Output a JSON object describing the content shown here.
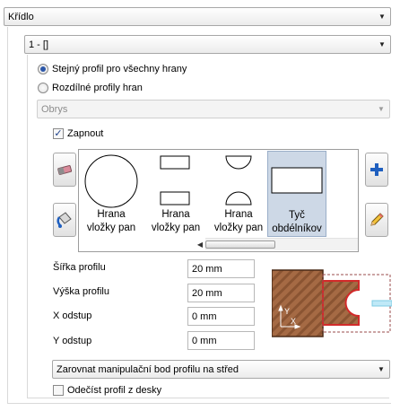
{
  "main_combo": {
    "value": "Křídlo"
  },
  "sub_combo": {
    "value": "1 - []"
  },
  "profile_mode": {
    "option_same": "Stejný profil pro všechny hrany",
    "option_different": "Rozdílné profily hran",
    "selected": "same"
  },
  "edge_combo": {
    "value": "Obrys",
    "disabled": true
  },
  "enable_checkbox": {
    "label": "Zapnout",
    "checked": true
  },
  "gallery": {
    "items": [
      {
        "line1": "Hrana",
        "line2": "vložky pan",
        "shape": "circle"
      },
      {
        "line1": "Hrana",
        "line2": "vložky pan",
        "shape": "two-rects"
      },
      {
        "line1": "Hrana",
        "line2": "vložky pan",
        "shape": "half-circles"
      },
      {
        "line1": "Tyč",
        "line2": "obdélníkov",
        "shape": "rect",
        "selected": true
      }
    ]
  },
  "fields": {
    "width": {
      "label": "Šířka profilu",
      "value": "20 mm"
    },
    "height": {
      "label": "Výška profilu",
      "value": "20 mm"
    },
    "x_offset": {
      "label": "X odstup",
      "value": "0 mm"
    },
    "y_offset": {
      "label": "Y odstup",
      "value": "0 mm"
    }
  },
  "preview": {
    "axis_x": "X",
    "axis_y": "Y"
  },
  "align_combo": {
    "value": "Zarovnat manipulační bod profilu na střed"
  },
  "subtract_checkbox": {
    "label": "Odečíst profil z desky",
    "checked": false
  },
  "icons": {
    "left_top": "eraser-icon",
    "left_bottom": "paint-bucket-icon",
    "right_top": "plus-icon",
    "right_bottom": "pencil-icon"
  },
  "colors": {
    "selection": "#cdd8e6",
    "plus_blue": "#1f5fbf",
    "wood": "#9c5e3b",
    "profile_red": "#d22a2a"
  }
}
